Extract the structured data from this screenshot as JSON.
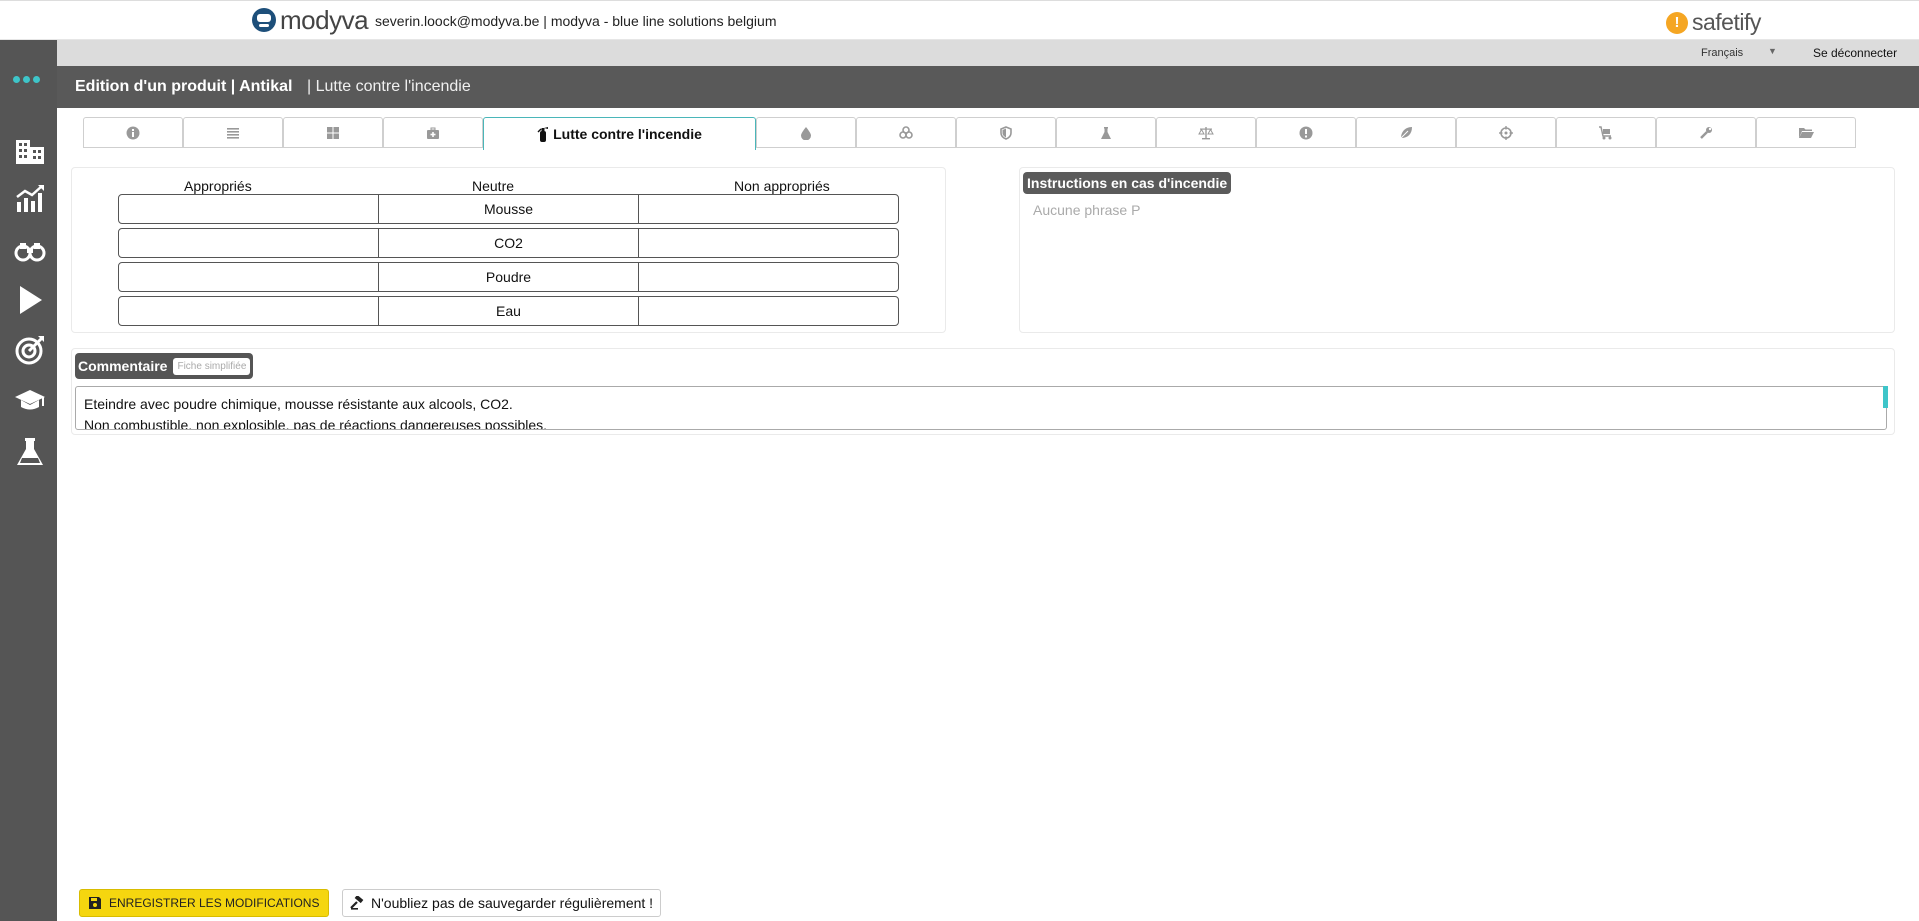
{
  "topbar": {
    "logo_text": "modyva",
    "user_info": "severin.loock@modyva.be | modyva - blue line solutions belgium",
    "brand_text": "safetify",
    "brand_icon_glyph": "!"
  },
  "langbar": {
    "language": "Français",
    "logout": "Se déconnecter"
  },
  "sidebar": {
    "icons": [
      "menu-dots-icon",
      "buildings-icon",
      "chart-icon",
      "binoculars-icon",
      "play-icon",
      "target-icon",
      "graduation-cap-icon",
      "flask-icon"
    ]
  },
  "titlebar": {
    "title": "Edition d'un produit | Antikal",
    "subtitle": "| Lutte contre l'incendie"
  },
  "tabs": {
    "active_label": "Lutte contre l'incendie",
    "icons": [
      "info-icon",
      "list-icon",
      "grid-icon",
      "first-aid-kit-icon",
      "fire-extinguisher-icon",
      "drop-icon",
      "biohazard-icon",
      "shield-icon",
      "flask-icon",
      "scales-icon",
      "exclamation-icon",
      "leaf-icon",
      "crosshair-icon",
      "cart-icon",
      "wrench-icon",
      "folder-icon"
    ]
  },
  "extinguishing": {
    "col_appropriate": "Appropriés",
    "col_neutral": "Neutre",
    "col_inappropriate": "Non appropriés",
    "rows": [
      {
        "appropriate": "",
        "neutral": "Mousse",
        "inappropriate": ""
      },
      {
        "appropriate": "",
        "neutral": "CO2",
        "inappropriate": ""
      },
      {
        "appropriate": "",
        "neutral": "Poudre",
        "inappropriate": ""
      },
      {
        "appropriate": "",
        "neutral": "Eau",
        "inappropriate": ""
      }
    ]
  },
  "instructions": {
    "title": "Instructions en cas d'incendie",
    "empty_text": "Aucune phrase P"
  },
  "comment": {
    "label": "Commentaire",
    "chip": "Fiche simplifiée",
    "line1": "Eteindre avec poudre chimique, mousse résistante aux alcools, CO2.",
    "line2": "Non combustible, non explosible, pas de réactions dangereuses possibles."
  },
  "footer": {
    "save_label": "ENREGISTRER LES MODIFICATIONS",
    "reminder": "N'oubliez pas de sauvegarder régulièrement !"
  },
  "colors": {
    "sidebar": "#555555",
    "accent": "#3ec5c9",
    "save_button": "#f5d60f",
    "brand_orange": "#f5a623"
  }
}
